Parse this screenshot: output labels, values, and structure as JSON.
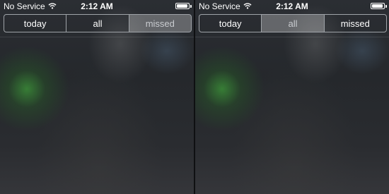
{
  "screens": [
    {
      "status": {
        "carrier": "No Service",
        "time": "2:12 AM"
      },
      "segments": [
        {
          "label": "today"
        },
        {
          "label": "all"
        },
        {
          "label": "missed"
        }
      ],
      "selected": "missed"
    },
    {
      "status": {
        "carrier": "No Service",
        "time": "2:12 AM"
      },
      "segments": [
        {
          "label": "today"
        },
        {
          "label": "all"
        },
        {
          "label": "missed"
        }
      ],
      "selected": "all"
    }
  ],
  "icons": {
    "wifi": "wifi-icon",
    "battery": "battery-icon"
  },
  "colors": {
    "segment_border": "#9fa3a8",
    "text": "#ffffff",
    "selected_text": "#c9ccd0"
  }
}
